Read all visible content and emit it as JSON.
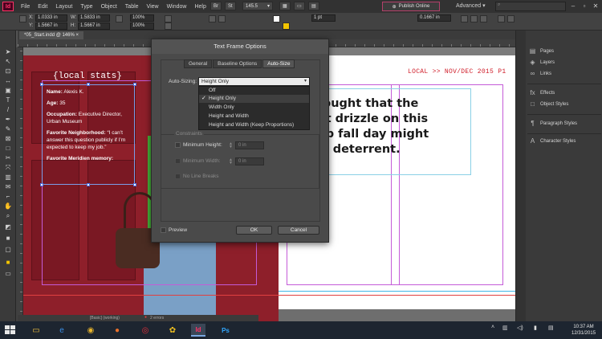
{
  "menubar": {
    "app_logo": "Id",
    "items": [
      "File",
      "Edit",
      "Layout",
      "Type",
      "Object",
      "Table",
      "View",
      "Window",
      "Help"
    ],
    "br_label": "Br",
    "st_label": "St",
    "zoom": "145.5",
    "publish_online": "Publish Online",
    "workspace": "Advanced"
  },
  "controlbar": {
    "x_label": "X:",
    "x_value": "1.0333 in",
    "y_label": "Y:",
    "y_value": "1.5667 in",
    "w_label": "W:",
    "w_value": "1.5833 in",
    "h_label": "H:",
    "h_value": "1.5667 in",
    "stroke_weight": "1 pt",
    "stroke_value": "0.1667 in",
    "zoom_pct": "100%"
  },
  "document": {
    "tab_label": "*05_Start.indd @ 146%",
    "folio": "LOCAL >> NOV/DEC 2015  P1",
    "body_text": "thought that the ght drizzle on this risp fall day might e a deterrent.",
    "body_lines": [
      "thought that the",
      "ght drizzle on this",
      "risp fall day might",
      "e a deterrent."
    ],
    "stats_title": "{local stats}",
    "stats": [
      {
        "label": "Name:",
        "value": "Alexis K."
      },
      {
        "label": "Age:",
        "value": "35"
      },
      {
        "label": "Occupation:",
        "value": "Executive Director, Urban Museum"
      },
      {
        "label": "Favorite Neighborhood:",
        "value": "“I can’t answer this question publicly if I’m expected to keep my job.”"
      },
      {
        "label": "Favorite Meridien memory:",
        "value": ""
      }
    ],
    "status": "[Basic] (working)",
    "status_errors": "2 errors"
  },
  "panels": [
    {
      "icon": "pages-icon",
      "glyph": "▤",
      "label": "Pages"
    },
    {
      "icon": "layers-icon",
      "glyph": "◈",
      "label": "Layers"
    },
    {
      "icon": "links-icon",
      "glyph": "∞",
      "label": "Links"
    },
    {
      "icon": "effects-icon",
      "glyph": "fx",
      "label": "Effects"
    },
    {
      "icon": "object-styles-icon",
      "glyph": "□",
      "label": "Object Styles"
    },
    {
      "icon": "paragraph-styles-icon",
      "glyph": "¶",
      "label": "Paragraph Styles"
    },
    {
      "icon": "character-styles-icon",
      "glyph": "A",
      "label": "Character Styles"
    }
  ],
  "dialog": {
    "title": "Text Frame Options",
    "tabs": [
      "General",
      "Baseline Options",
      "Auto-Size"
    ],
    "active_tab": "Auto-Size",
    "auto_sizing_label": "Auto-Sizing:",
    "auto_sizing_value": "Height Only",
    "options": [
      "Off",
      "Height Only",
      "Width Only",
      "Height and Width",
      "Height and Width (Keep Proportions)"
    ],
    "selected_option": "Height Only",
    "constraints_label": "Constraints",
    "min_height_label": "Minimum Height:",
    "min_height_value": "0 in",
    "min_width_label": "Minimum Width:",
    "min_width_value": "0 in",
    "no_line_breaks_label": "No Line Breaks",
    "preview_label": "Preview",
    "ok_label": "OK",
    "cancel_label": "Cancel"
  },
  "taskbar": {
    "time": "10:37 AM",
    "date": "12/31/2015",
    "indesign_label": "Id",
    "photoshop_label": "Ps"
  },
  "colors": {
    "accent": "#ff3366",
    "folio_red": "#d0202c",
    "door_red": "#8e1f2a",
    "jacket_green": "#47b33a"
  }
}
